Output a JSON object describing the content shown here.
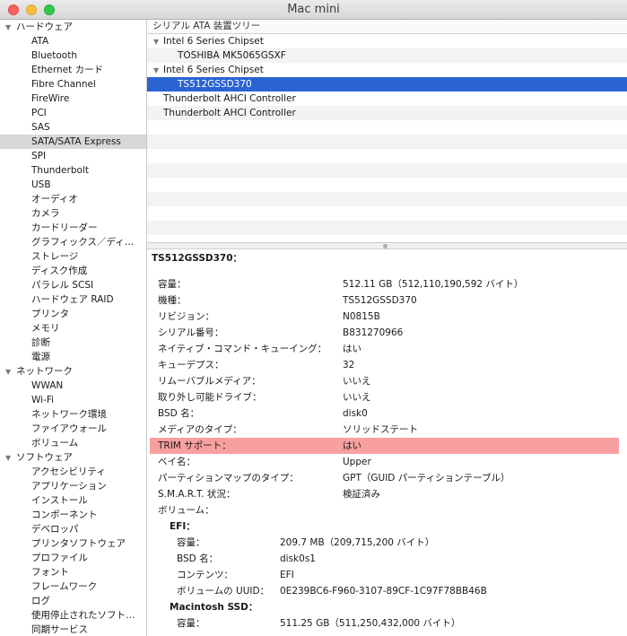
{
  "window": {
    "title": "Mac mini"
  },
  "sidebar": {
    "items": [
      {
        "label": "ハードウェア",
        "type": "cat"
      },
      {
        "label": "ATA",
        "type": "item"
      },
      {
        "label": "Bluetooth",
        "type": "item"
      },
      {
        "label": "Ethernet カード",
        "type": "item"
      },
      {
        "label": "Fibre Channel",
        "type": "item"
      },
      {
        "label": "FireWire",
        "type": "item"
      },
      {
        "label": "PCI",
        "type": "item"
      },
      {
        "label": "SAS",
        "type": "item"
      },
      {
        "label": "SATA/SATA Express",
        "type": "item",
        "selected": true
      },
      {
        "label": "SPI",
        "type": "item"
      },
      {
        "label": "Thunderbolt",
        "type": "item"
      },
      {
        "label": "USB",
        "type": "item"
      },
      {
        "label": "オーディオ",
        "type": "item"
      },
      {
        "label": "カメラ",
        "type": "item"
      },
      {
        "label": "カードリーダー",
        "type": "item"
      },
      {
        "label": "グラフィックス／ディ…",
        "type": "item"
      },
      {
        "label": "ストレージ",
        "type": "item"
      },
      {
        "label": "ディスク作成",
        "type": "item"
      },
      {
        "label": "パラレル SCSI",
        "type": "item"
      },
      {
        "label": "ハードウェア RAID",
        "type": "item"
      },
      {
        "label": "プリンタ",
        "type": "item"
      },
      {
        "label": "メモリ",
        "type": "item"
      },
      {
        "label": "診断",
        "type": "item"
      },
      {
        "label": "電源",
        "type": "item"
      },
      {
        "label": "ネットワーク",
        "type": "cat"
      },
      {
        "label": "WWAN",
        "type": "item"
      },
      {
        "label": "Wi-Fi",
        "type": "item"
      },
      {
        "label": "ネットワーク環境",
        "type": "item"
      },
      {
        "label": "ファイアウォール",
        "type": "item"
      },
      {
        "label": "ボリューム",
        "type": "item"
      },
      {
        "label": "ソフトウェア",
        "type": "cat"
      },
      {
        "label": "アクセシビリティ",
        "type": "item"
      },
      {
        "label": "アプリケーション",
        "type": "item"
      },
      {
        "label": "インストール",
        "type": "item"
      },
      {
        "label": "コンポーネント",
        "type": "item"
      },
      {
        "label": "デベロッパ",
        "type": "item"
      },
      {
        "label": "プリンタソフトウェア",
        "type": "item"
      },
      {
        "label": "プロファイル",
        "type": "item"
      },
      {
        "label": "フォント",
        "type": "item"
      },
      {
        "label": "フレームワーク",
        "type": "item"
      },
      {
        "label": "ログ",
        "type": "item"
      },
      {
        "label": "使用停止されたソフト…",
        "type": "item"
      },
      {
        "label": "同期サービス",
        "type": "item"
      }
    ]
  },
  "tree": {
    "header": "シリアル ATA 装置ツリー",
    "rows": [
      {
        "label": "Intel 6 Series Chipset",
        "level": 0,
        "expander": true
      },
      {
        "label": "TOSHIBA MK5065GSXF",
        "level": 1
      },
      {
        "label": "Intel 6 Series Chipset",
        "level": 0,
        "expander": true
      },
      {
        "label": "TS512GSSD370",
        "level": 1,
        "selected": true
      },
      {
        "label": "Thunderbolt AHCI Controller",
        "level": 0
      },
      {
        "label": "Thunderbolt AHCI Controller",
        "level": 0
      },
      {
        "label": "",
        "level": 0
      },
      {
        "label": "",
        "level": 0
      },
      {
        "label": "",
        "level": 0
      },
      {
        "label": "",
        "level": 0
      },
      {
        "label": "",
        "level": 0
      },
      {
        "label": "",
        "level": 0
      },
      {
        "label": "",
        "level": 0
      },
      {
        "label": "",
        "level": 0
      }
    ]
  },
  "detail": {
    "title": "TS512GSSD370：",
    "rows": [
      {
        "key": "容量：",
        "value": "512.11 GB（512,110,190,592 バイト）"
      },
      {
        "key": "機種：",
        "value": "TS512GSSD370"
      },
      {
        "key": "リビジョン：",
        "value": "N0815B"
      },
      {
        "key": "シリアル番号：",
        "value": "B831270966"
      },
      {
        "key": "ネイティブ・コマンド・キューイング：",
        "value": "はい"
      },
      {
        "key": "キューデプス：",
        "value": "32"
      },
      {
        "key": "リムーバブルメディア：",
        "value": "いいえ"
      },
      {
        "key": "取り外し可能ドライブ：",
        "value": "いいえ"
      },
      {
        "key": "BSD 名：",
        "value": "disk0"
      },
      {
        "key": "メディアのタイプ：",
        "value": "ソリッドステート"
      },
      {
        "key": "TRIM サポート：",
        "value": "はい",
        "highlight": true
      },
      {
        "key": "ベイ名：",
        "value": "Upper"
      },
      {
        "key": "パーティションマップのタイプ：",
        "value": "GPT（GUID パーティションテーブル）"
      },
      {
        "key": "S.M.A.R.T. 状況：",
        "value": "検証済み"
      },
      {
        "key": "ボリューム：",
        "value": ""
      },
      {
        "key": "EFI：",
        "value": "",
        "sub": true,
        "indent": 1
      },
      {
        "key": "容量：",
        "value": "209.7 MB（209,715,200 バイト）",
        "indent": 2
      },
      {
        "key": "BSD 名：",
        "value": "disk0s1",
        "indent": 2
      },
      {
        "key": "コンテンツ：",
        "value": "EFI",
        "indent": 2
      },
      {
        "key": "ボリュームの UUID：",
        "value": "0E239BC6-F960-3107-89CF-1C97F78BB46B",
        "indent": 2
      },
      {
        "key": "Macintosh SSD：",
        "value": "",
        "sub": true,
        "indent": 1
      },
      {
        "key": "容量：",
        "value": "511.25 GB（511,250,432,000 バイト）",
        "indent": 2
      }
    ]
  },
  "colors": {
    "selection": "#2a64d2",
    "trim_highlight": "#f8a0a0"
  },
  "icons": [
    "close-button",
    "minimize-button",
    "zoom-button",
    "disclosure-triangle-icon"
  ]
}
